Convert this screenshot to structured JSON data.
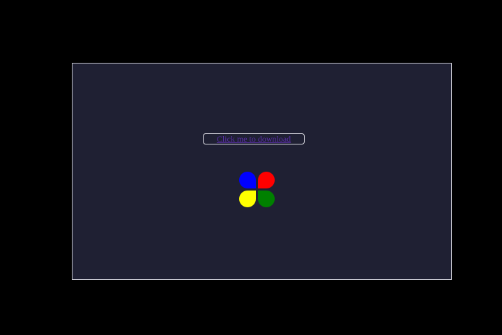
{
  "download": {
    "link_text": "Click me to download"
  },
  "colors": {
    "background": "#000000",
    "panel": "#1f2033",
    "panel_border": "#c8c8d2",
    "link": "#5a2fa8",
    "petal_blue": "#0000ff",
    "petal_red": "#ff0000",
    "petal_yellow": "#ffff00",
    "petal_green": "#008000"
  },
  "icons": {
    "spinner": "four-petal-spinner-icon"
  }
}
